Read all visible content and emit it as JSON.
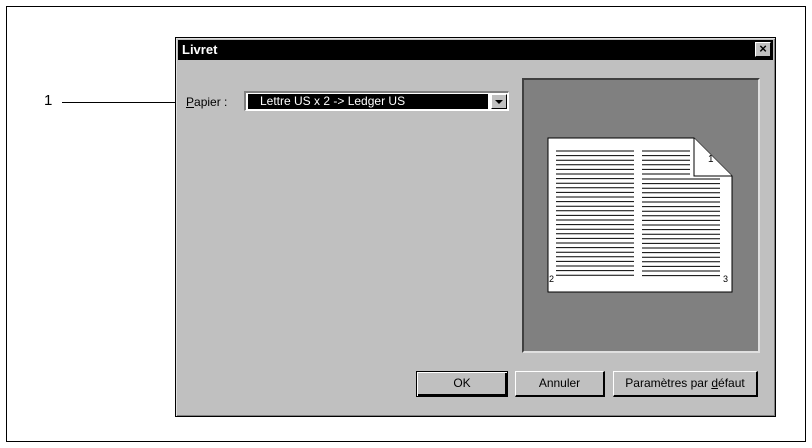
{
  "callout": {
    "number": "1"
  },
  "dialog": {
    "title": "Livret",
    "close_symbol": "×",
    "paper": {
      "label": "Papier :",
      "selected_value": "Lettre US x 2 -> Ledger US"
    },
    "preview": {
      "left_page_number": "2",
      "right_page_number": "3",
      "corner_mark": "1"
    },
    "buttons": {
      "ok": "OK",
      "cancel": "Annuler",
      "default_prefix": "Paramètres par ",
      "default_underlined": "d",
      "default_suffix": "éfaut"
    }
  }
}
